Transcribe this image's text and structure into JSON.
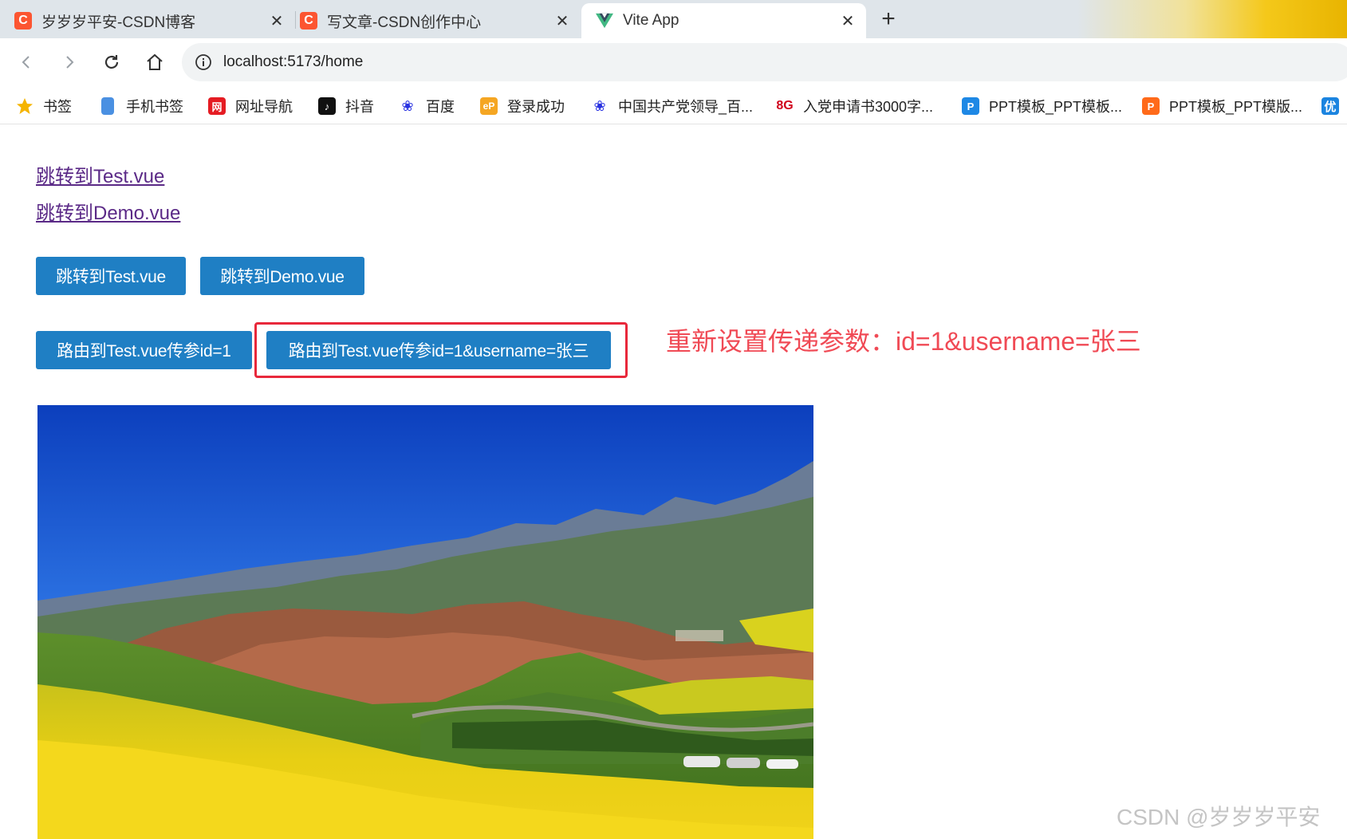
{
  "browser": {
    "tabs": [
      {
        "title": "岁岁岁平安-CSDN博客",
        "favicon": "csdn-icon",
        "active": false
      },
      {
        "title": "写文章-CSDN创作中心",
        "favicon": "csdn-icon",
        "active": false
      },
      {
        "title": "Vite App",
        "favicon": "vue-icon",
        "active": true
      }
    ],
    "address_bar": {
      "url": "localhost:5173/home"
    },
    "bookmarks": [
      {
        "label": "书签",
        "icon": "star-icon"
      },
      {
        "label": "手机书签",
        "icon": "phone-icon"
      },
      {
        "label": "网址导航",
        "icon": "navigation-icon"
      },
      {
        "label": "抖音",
        "icon": "douyin-icon"
      },
      {
        "label": "百度",
        "icon": "baidu-icon"
      },
      {
        "label": "登录成功",
        "icon": "ep-icon"
      },
      {
        "label": "中国共产党领导_百...",
        "icon": "baidu-icon"
      },
      {
        "label": "入党申请书3000字...",
        "icon": "8g-icon"
      },
      {
        "label": "PPT模板_PPT模板...",
        "icon": "ppt-blue-icon"
      },
      {
        "label": "PPT模板_PPT模版...",
        "icon": "ppt-orange-icon"
      },
      {
        "label": "优",
        "icon": "you-icon"
      }
    ]
  },
  "page": {
    "links": [
      "跳转到Test.vue",
      "跳转到Demo.vue"
    ],
    "nav_buttons": [
      "跳转到Test.vue",
      "跳转到Demo.vue"
    ],
    "route_buttons": [
      "路由到Test.vue传参id=1",
      "路由到Test.vue传参id=1&username=张三"
    ],
    "annotation": "重新设置传递参数：id=1&username=张三",
    "watermark": "CSDN @岁岁岁平安"
  },
  "colors": {
    "button_bg": "#1f7fc4",
    "link": "#5b2a87",
    "annotation": "#f04a55",
    "highlight_border": "#e8283b",
    "csdn_brand": "#fc5531"
  }
}
